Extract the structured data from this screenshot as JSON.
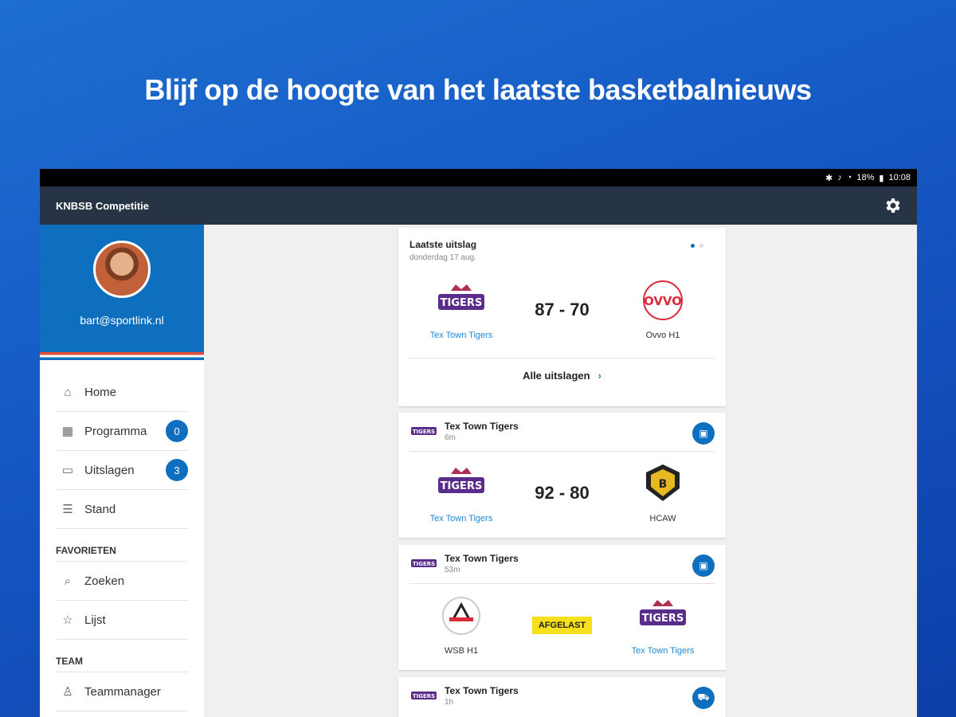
{
  "headline": "Blijf op de hoogte van het laatste basketbalnieuws",
  "status_bar": {
    "battery": "18%",
    "time": "10:08"
  },
  "app_bar": {
    "title": "KNBSB Competitie",
    "settings_icon": "gear-icon"
  },
  "profile": {
    "email": "bart@sportlink.nl"
  },
  "nav": {
    "items": [
      {
        "label": "Home",
        "icon": "home-icon"
      },
      {
        "label": "Programma",
        "icon": "calendar-icon",
        "badge": "0"
      },
      {
        "label": "Uitslagen",
        "icon": "scoreboard-icon",
        "badge": "3"
      },
      {
        "label": "Stand",
        "icon": "list-icon"
      }
    ],
    "favorites_label": "FAVORIETEN",
    "favorites": [
      {
        "label": "Zoeken",
        "icon": "search-icon"
      },
      {
        "label": "Lijst",
        "icon": "star-icon"
      }
    ],
    "team_label": "TEAM",
    "team": [
      {
        "label": "Teammanager",
        "icon": "person-icon"
      }
    ]
  },
  "latest_result": {
    "title": "Laatste uitslag",
    "date": "donderdag 17 aug.",
    "home": "Tex Town Tigers",
    "away": "Ovvo H1",
    "score": "87 - 70",
    "footer": "Alle uitslagen"
  },
  "feed": [
    {
      "team": "Tex Town Tigers",
      "ago": "6m",
      "home": "Tex Town Tigers",
      "away": "HCAW",
      "score": "92 - 80"
    },
    {
      "team": "Tex Town Tigers",
      "ago": "53m",
      "home": "WSB H1",
      "away": "Tex Town Tigers",
      "status": "AFGELAST"
    },
    {
      "team": "Tex Town Tigers",
      "ago": "1h"
    }
  ],
  "colors": {
    "primary": "#0e6fbe",
    "appbar": "#263445",
    "link": "#1f87d8",
    "postponed": "#f6df1b"
  }
}
